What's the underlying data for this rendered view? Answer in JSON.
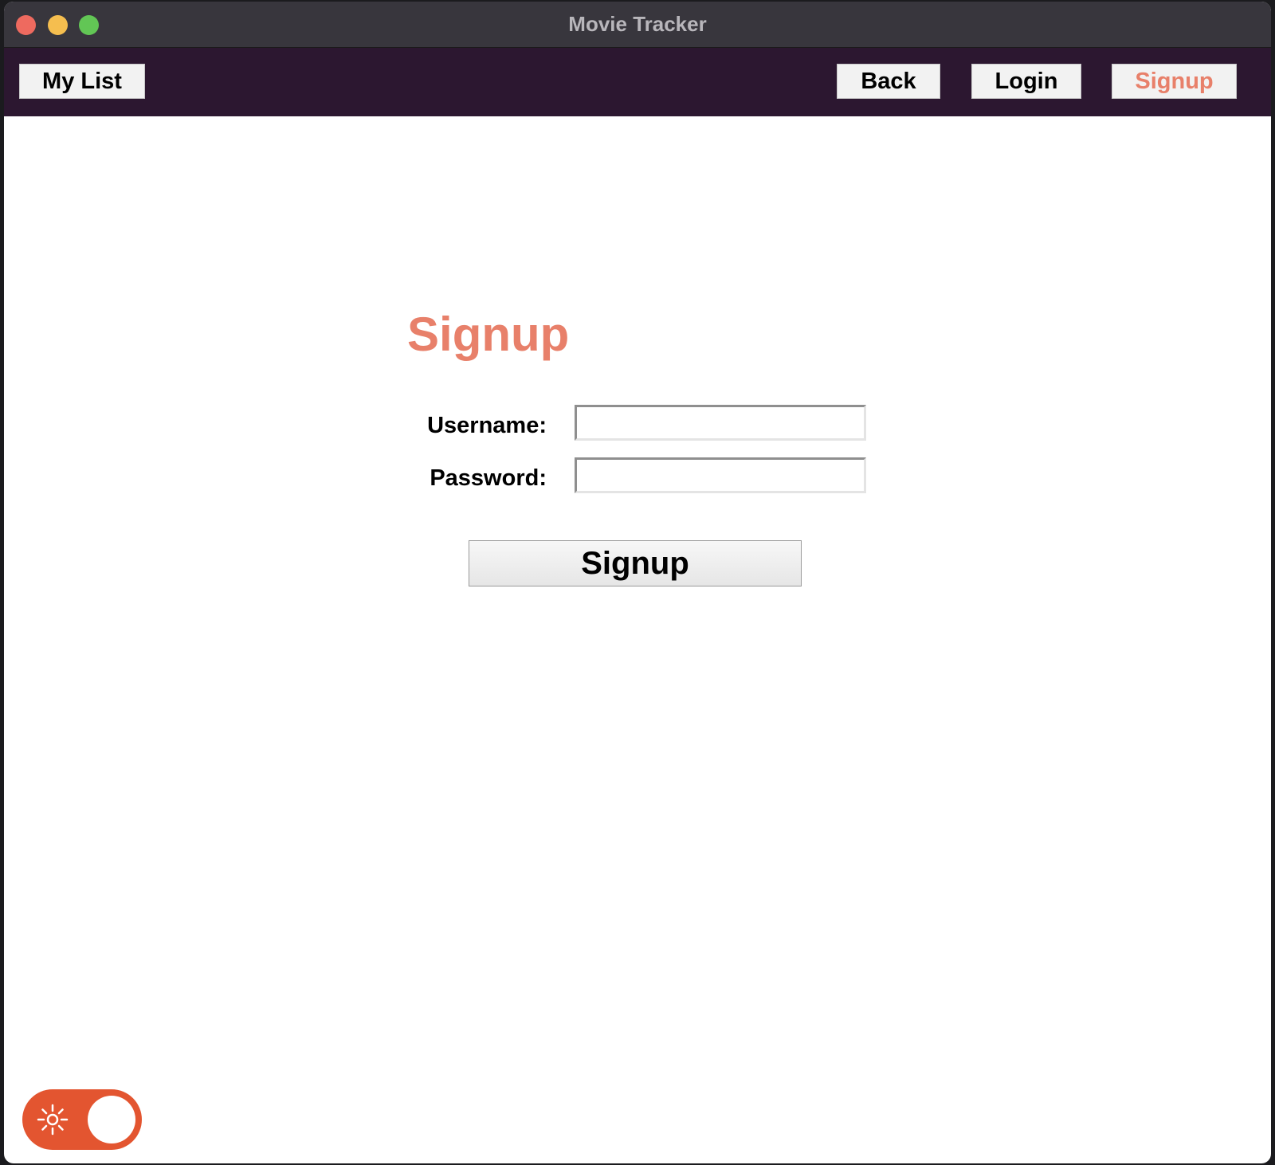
{
  "window": {
    "title": "Movie Tracker"
  },
  "navbar": {
    "my_list_label": "My List",
    "back_label": "Back",
    "login_label": "Login",
    "signup_label": "Signup",
    "active_item": "Signup"
  },
  "form": {
    "heading": "Signup",
    "username_label": "Username:",
    "username_value": "",
    "password_label": "Password:",
    "password_value": "",
    "submit_label": "Signup"
  },
  "theme_toggle": {
    "icon": "sun-icon",
    "mode": "light"
  },
  "colors": {
    "accent": "#e8806a",
    "navbar_bg": "#2c1730",
    "titlebar_bg": "#38363d",
    "toggle_bg": "#e35530"
  }
}
